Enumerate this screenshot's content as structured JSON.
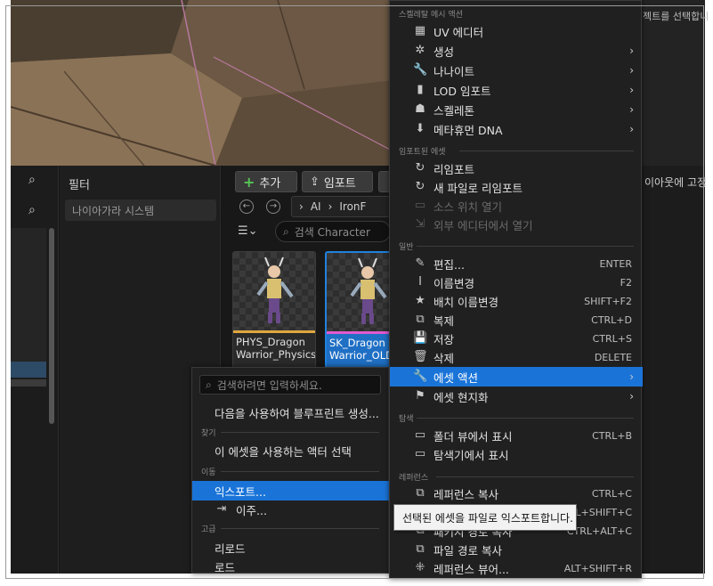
{
  "viewport_right_text": "젝트를 선택합니",
  "side_text": "이아웃에 고정",
  "filter": {
    "title": "필터",
    "item": "나이아가라 시스템"
  },
  "toolbar": {
    "add_label": "추가",
    "import_label": "임포트"
  },
  "path": [
    "AI",
    "IronF"
  ],
  "search_placeholder": "검색 Character",
  "assets": [
    {
      "name": "PHYS_Dragon\nWarrior_Physics",
      "color": "#e0a640",
      "selected": false
    },
    {
      "name": "SK_Dragon\nWarrior_OLD",
      "color": "#e05ad0",
      "selected": true
    }
  ],
  "main_menu": {
    "sections": {
      "skeletal": "스켈레탈 메시 액션",
      "imported": "임포트된 에셋",
      "general": "일반",
      "explore": "탐색",
      "references": "레퍼런스"
    },
    "items": [
      {
        "label": "UV 에디터",
        "icon": "uv-grid-icon",
        "glyph": "▦",
        "shortcut": "",
        "arrow": false
      },
      {
        "label": "생성",
        "icon": "sparkle-icon",
        "glyph": "✲",
        "shortcut": "",
        "arrow": true
      },
      {
        "label": "나나이트",
        "icon": "wrench-icon",
        "glyph": "🔧",
        "shortcut": "",
        "arrow": true
      },
      {
        "label": "LOD 임포트",
        "icon": "lod-icon",
        "glyph": "▮",
        "shortcut": "",
        "arrow": true
      },
      {
        "label": "스켈레톤",
        "icon": "skeleton-icon",
        "glyph": "☗",
        "shortcut": "",
        "arrow": true
      },
      {
        "label": "메타휴먼 DNA",
        "icon": "import-icon",
        "glyph": "⬇",
        "shortcut": "",
        "arrow": true
      },
      {
        "label": "리임포트",
        "icon": "reimport-icon",
        "glyph": "↻",
        "shortcut": "",
        "arrow": false
      },
      {
        "label": "새 파일로 리임포트",
        "icon": "reimport-new-icon",
        "glyph": "↻",
        "shortcut": "",
        "arrow": false
      },
      {
        "label": "소스 위치 열기",
        "icon": "folder-open-icon",
        "glyph": "▭",
        "shortcut": "",
        "arrow": false,
        "disabled": true
      },
      {
        "label": "외부 에디터에서 열기",
        "icon": "external-icon",
        "glyph": "⇲",
        "shortcut": "",
        "arrow": false,
        "disabled": true
      },
      {
        "label": "편집...",
        "icon": "pencil-icon",
        "glyph": "✎",
        "shortcut": "ENTER",
        "arrow": false
      },
      {
        "label": "이름변경",
        "icon": "rename-icon",
        "glyph": "Ⅰ",
        "shortcut": "F2",
        "arrow": false
      },
      {
        "label": "배치 이름변경",
        "icon": "star-icon",
        "glyph": "★",
        "shortcut": "SHIFT+F2",
        "arrow": false
      },
      {
        "label": "복제",
        "icon": "duplicate-icon",
        "glyph": "⧉",
        "shortcut": "CTRL+D",
        "arrow": false
      },
      {
        "label": "저장",
        "icon": "save-icon",
        "glyph": "💾",
        "shortcut": "CTRL+S",
        "arrow": false
      },
      {
        "label": "삭제",
        "icon": "trash-icon",
        "glyph": "🗑",
        "shortcut": "DELETE",
        "arrow": false
      },
      {
        "label": "에셋 액션",
        "icon": "wrench-icon",
        "glyph": "🔧",
        "shortcut": "",
        "arrow": true,
        "highlighted": true
      },
      {
        "label": "에셋 현지화",
        "icon": "flag-icon",
        "glyph": "⚑",
        "shortcut": "",
        "arrow": true
      },
      {
        "label": "폴더 뷰에서 표시",
        "icon": "folder-search-icon",
        "glyph": "▭",
        "shortcut": "CTRL+B",
        "arrow": false
      },
      {
        "label": "탐색기에서 표시",
        "icon": "folder-icon",
        "glyph": "▭",
        "shortcut": "",
        "arrow": false
      },
      {
        "label": "레퍼런스 복사",
        "icon": "copy-ref-icon",
        "glyph": "⧉",
        "shortcut": "CTRL+C",
        "arrow": false
      },
      {
        "label": "레퍼런스 복사",
        "icon": "copy-path-icon",
        "glyph": "⧉",
        "shortcut": "CTRL+SHIFT+C",
        "arrow": false
      },
      {
        "label": "패키지 경로 복사",
        "icon": "copy-pkg-icon",
        "glyph": "⧉",
        "shortcut": "CTRL+ALT+C",
        "arrow": false
      },
      {
        "label": "파일 경로 복사",
        "icon": "copy-file-icon",
        "glyph": "⧉",
        "shortcut": "",
        "arrow": false
      },
      {
        "label": "레퍼런스 뷰어...",
        "icon": "ref-viewer-icon",
        "glyph": "⁜",
        "shortcut": "ALT+SHIFT+R",
        "arrow": false
      }
    ]
  },
  "sub_menu": {
    "search_placeholder": "검색하려면 입력하세요.",
    "sections": {
      "find": "찾기",
      "move": "이동",
      "advanced": "고급"
    },
    "items": [
      {
        "label": "다음을 사용하여 블루프린트 생성...",
        "icon": "",
        "highlighted": false
      },
      {
        "label": "이 에셋을 사용하는 액터 선택",
        "icon": "",
        "highlighted": false
      },
      {
        "label": "익스포트...",
        "icon": "",
        "highlighted": true
      },
      {
        "label": "이주...",
        "icon": "migrate-icon",
        "highlighted": false
      },
      {
        "label": "리로드",
        "icon": "",
        "highlighted": false
      },
      {
        "label": "로드",
        "icon": "",
        "highlighted": false
      }
    ]
  },
  "tooltip": "선택된 에셋을 파일로 익스포트합니다."
}
